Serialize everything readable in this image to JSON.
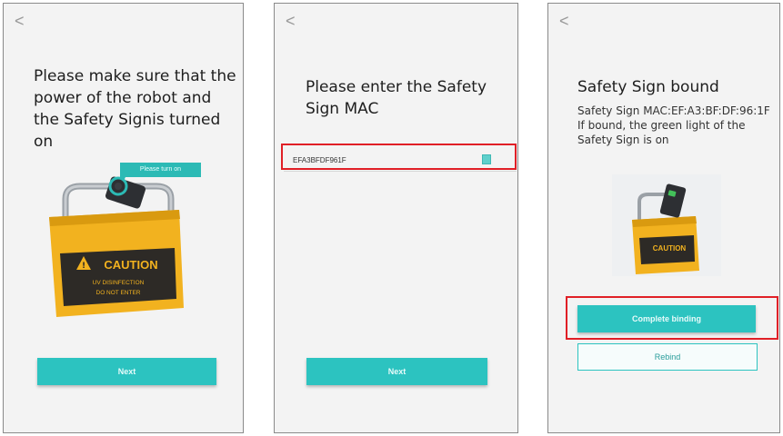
{
  "screens": [
    {
      "back_glyph": "<",
      "title": "Please make sure that the power of the robot and the Safety Signis turned on",
      "callout": "Please turn on",
      "sign": {
        "header": "CAUTION",
        "line1": "UV DISINFECTION",
        "line2": "DO NOT ENTER"
      },
      "next_label": "Next"
    },
    {
      "back_glyph": "<",
      "title": "Please enter the Safety Sign MAC",
      "mac_value": "EFA3BFDF961F",
      "next_label": "Next"
    },
    {
      "back_glyph": "<",
      "title": "Safety Sign bound",
      "subtitle": "Safety Sign MAC:EF:A3:BF:DF:96:1F If bound, the green light of the Safety Sign is on",
      "sign": {
        "header": "CAUTION"
      },
      "complete_label": "Complete binding",
      "rebind_label": "Rebind"
    }
  ],
  "colors": {
    "accent": "#2cc3c0",
    "highlight": "#e01f26",
    "caution": "#f2b21f"
  },
  "icons": [
    "back-chevron-icon",
    "clear-input-icon"
  ]
}
